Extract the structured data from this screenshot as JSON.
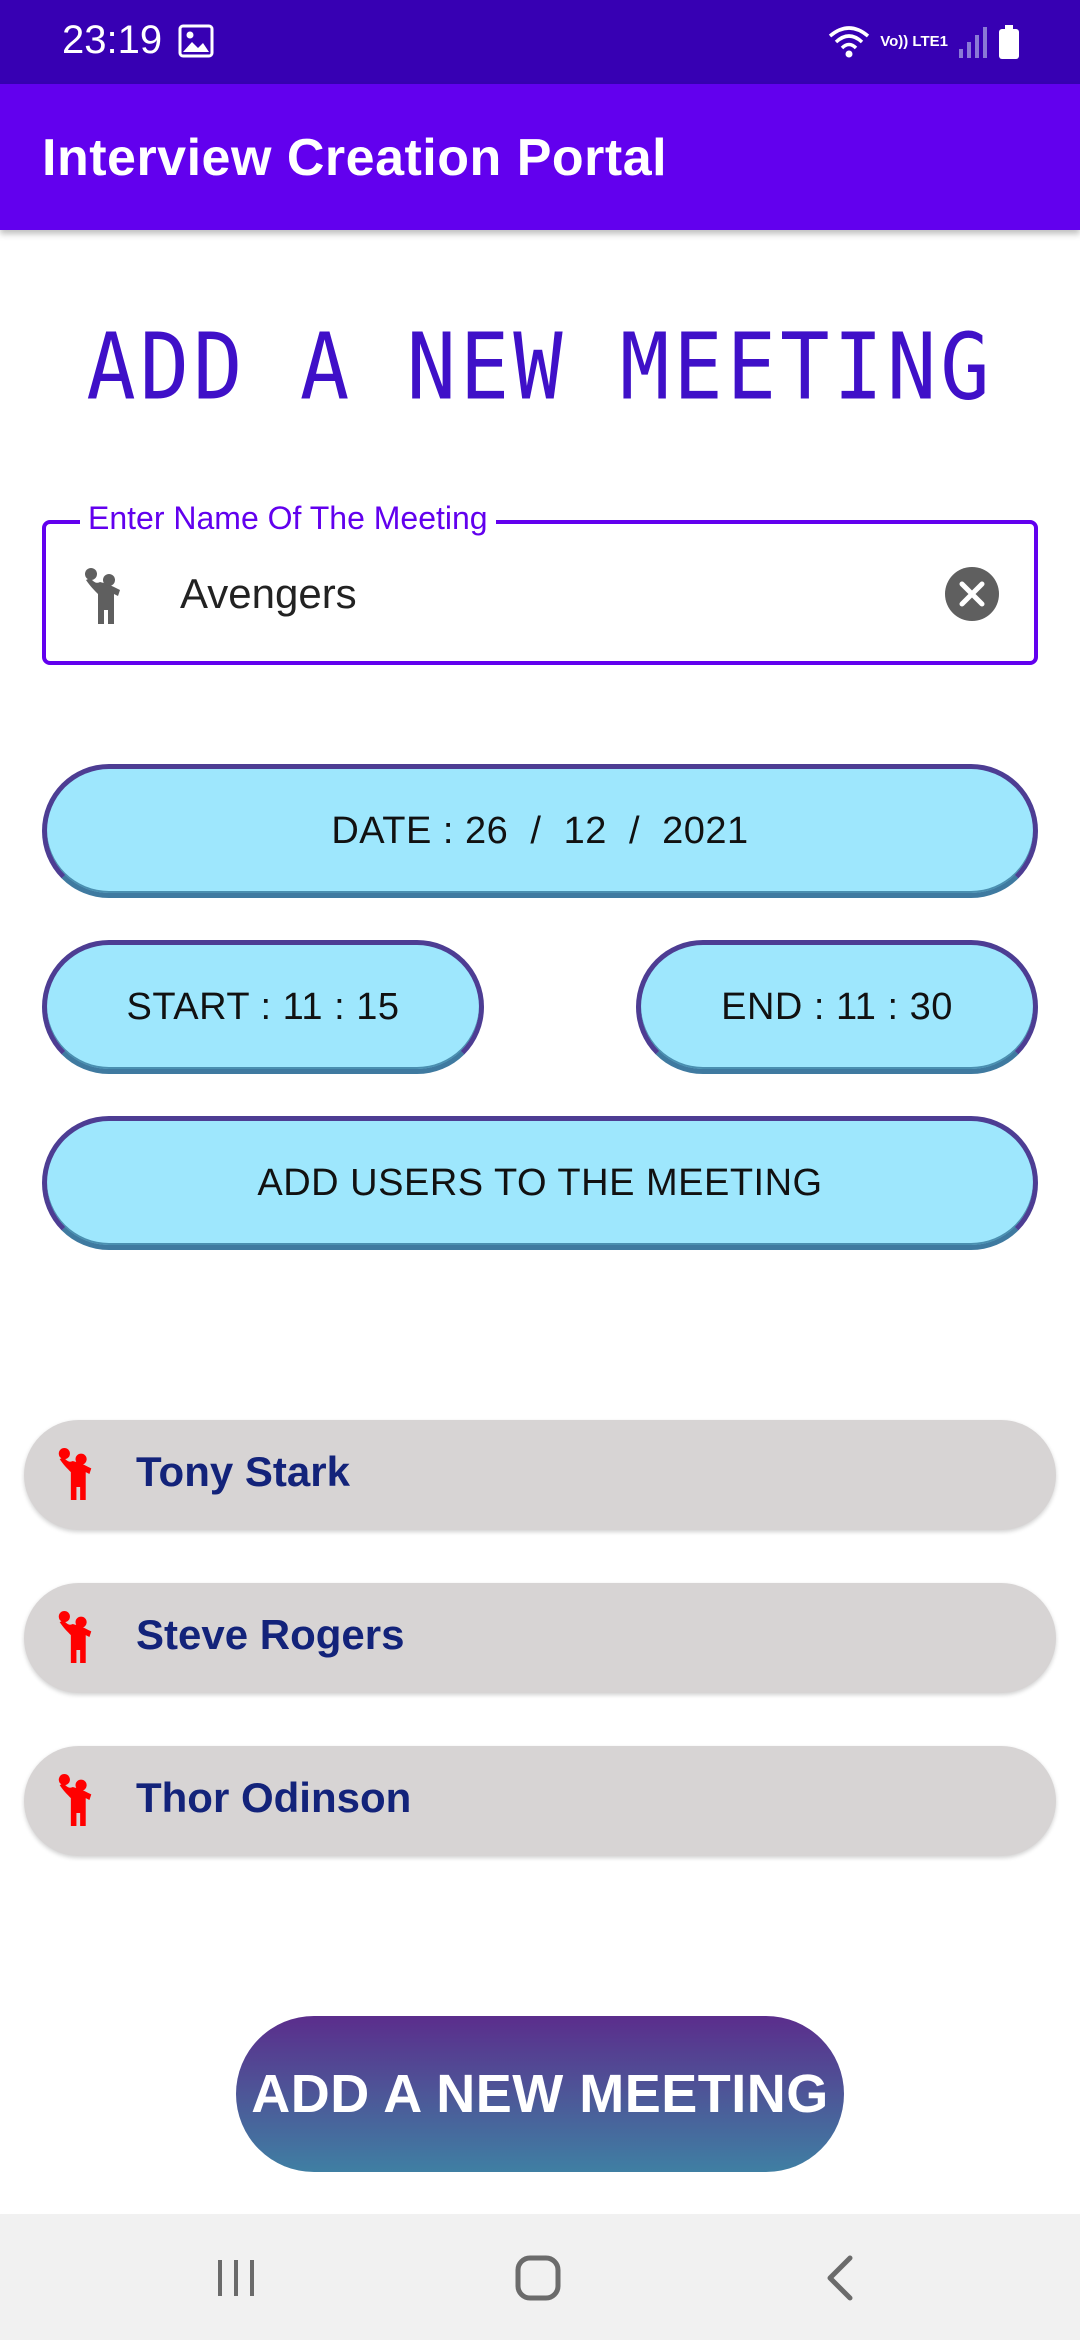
{
  "status_bar": {
    "time": "23:19",
    "network_label": "Vo)) LTE1",
    "icons": [
      "gallery-icon",
      "wifi-icon",
      "lte-icon",
      "signal-icon",
      "battery-icon"
    ]
  },
  "app_bar": {
    "title": "Interview Creation Portal"
  },
  "page": {
    "title": "ADD A NEW MEETING"
  },
  "meeting_name_field": {
    "label": "Enter Name Of The Meeting",
    "value": "Avengers",
    "leading_icon": "person-raising-hand-icon",
    "trailing_icon": "clear-circle-icon"
  },
  "buttons": {
    "date": "DATE : 26  /  12  /  2021",
    "start": "START : 11 : 15",
    "end": "END : 11 : 30",
    "add_users": "ADD USERS TO THE MEETING",
    "add_meeting": "ADD A NEW MEETING"
  },
  "users": [
    {
      "name": "Tony Stark",
      "icon": "person-raising-hand-icon"
    },
    {
      "name": "Steve Rogers",
      "icon": "person-raising-hand-icon"
    },
    {
      "name": "Thor Odinson",
      "icon": "person-raising-hand-icon"
    }
  ],
  "nav_bar": {
    "icons": [
      "recent-apps-icon",
      "home-icon",
      "back-icon"
    ]
  },
  "colors": {
    "status_bar": "#3700b3",
    "app_bar": "#6200ee",
    "title_text": "#3f10c8",
    "pill_fill": "#9ee7fd",
    "user_item_bg": "#d7d4d4",
    "user_name": "#13237a",
    "user_icon": "#ff0000",
    "cta_gradient_top": "#5b2d8c",
    "cta_gradient_bottom": "#3f7fa3"
  }
}
